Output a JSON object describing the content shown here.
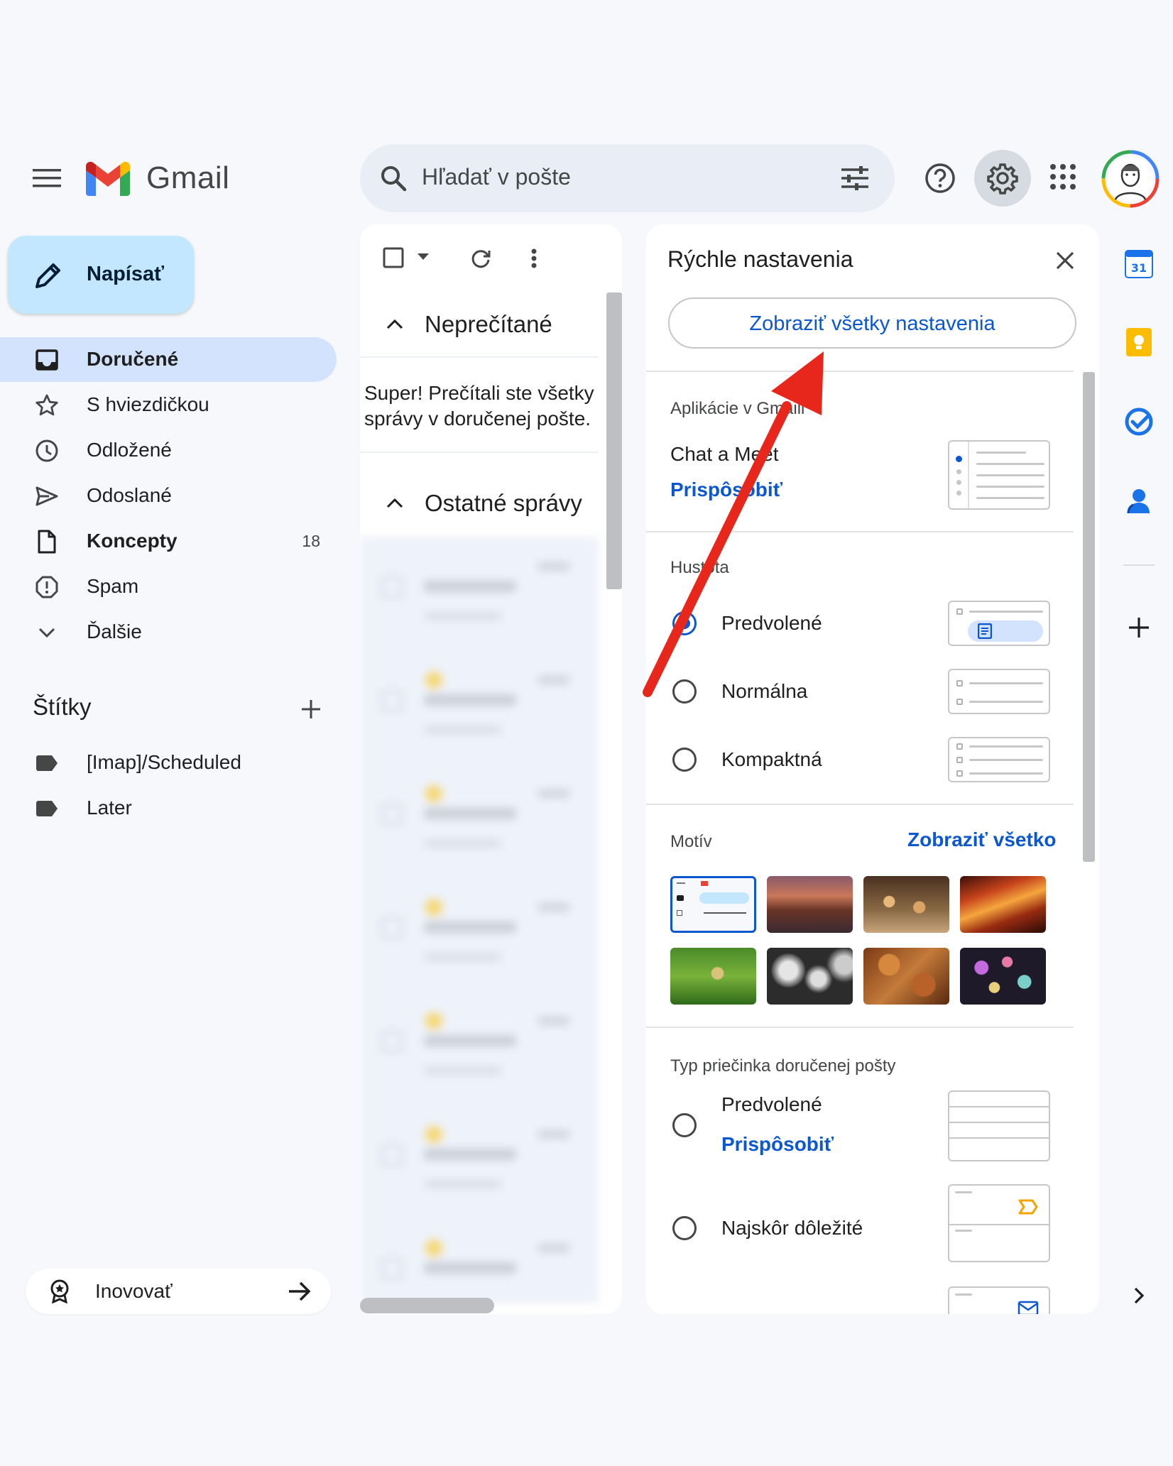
{
  "app": {
    "name": "Gmail"
  },
  "search": {
    "placeholder": "Hľadať v pošte"
  },
  "compose": {
    "label": "Napísať"
  },
  "nav": {
    "items": [
      {
        "label": "Doručené",
        "icon": "inbox-icon",
        "active": true,
        "bold": true
      },
      {
        "label": "S hviezdičkou",
        "icon": "star-icon"
      },
      {
        "label": "Odložené",
        "icon": "clock-icon"
      },
      {
        "label": "Odoslané",
        "icon": "send-icon"
      },
      {
        "label": "Koncepty",
        "icon": "draft-icon",
        "bold": true,
        "count": "18"
      },
      {
        "label": "Spam",
        "icon": "spam-icon"
      },
      {
        "label": "Ďalšie",
        "icon": "chevron-down-icon"
      }
    ]
  },
  "labels": {
    "title": "Štítky",
    "items": [
      {
        "label": "[Imap]/Scheduled"
      },
      {
        "label": "Later"
      }
    ]
  },
  "upgrade": {
    "label": "Inovovať"
  },
  "list": {
    "unread_title": "Neprečítané",
    "empty_message": "Super! Prečítali ste všetky správy v doručenej pošte.",
    "other_title": "Ostatné správy"
  },
  "quick_settings": {
    "title": "Rýchle nastavenia",
    "all_settings_button": "Zobraziť všetky nastavenia",
    "apps": {
      "section_label": "Aplikácie v Gmaili",
      "item": "Chat a Meet",
      "link": "Prispôsobiť"
    },
    "density": {
      "section_label": "Hustota",
      "options": [
        {
          "label": "Predvolené",
          "selected": true
        },
        {
          "label": "Normálna",
          "selected": false
        },
        {
          "label": "Kompaktná",
          "selected": false
        }
      ]
    },
    "theme": {
      "section_label": "Motív",
      "view_all": "Zobraziť všetko"
    },
    "inbox_type": {
      "section_label": "Typ priečinka doručenej pošty",
      "options": [
        {
          "label": "Predvolené",
          "link": "Prispôsobiť"
        },
        {
          "label": "Najskôr dôležité"
        }
      ]
    }
  },
  "colors": {
    "accent": "#0b57d0",
    "compose_bg": "#c2e7ff",
    "active_nav_bg": "#d3e3fd",
    "arrow": "#e8271c"
  }
}
